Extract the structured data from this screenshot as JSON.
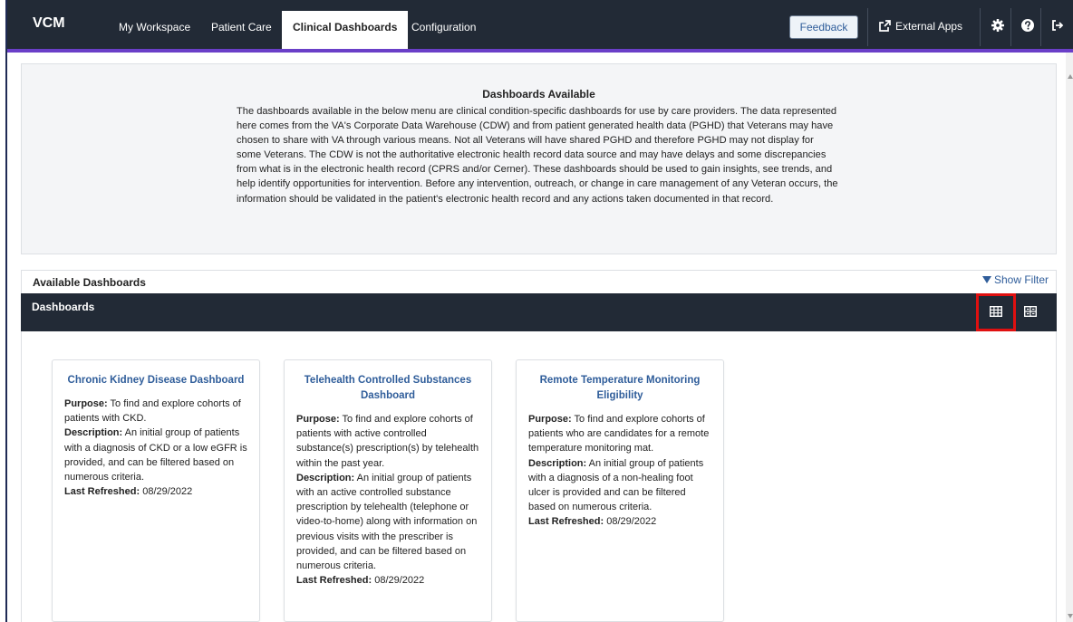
{
  "nav": {
    "brand": "VCM",
    "items": [
      "My Workspace",
      "Patient Care",
      "Clinical Dashboards",
      "Configuration"
    ],
    "feedback": "Feedback",
    "external_apps": "External Apps",
    "icons": [
      "gear-icon",
      "help-icon",
      "logout-icon"
    ]
  },
  "info": {
    "title": "Dashboards Available",
    "body": "The dashboards available in the below menu are clinical condition-specific dashboards for use by care providers. The data represented here comes from the VA's Corporate Data Warehouse (CDW) and from patient generated health data (PGHD) that Veterans may have chosen to share with VA through various means. Not all Veterans will have shared PGHD and therefore PGHD may not display for some Veterans. The CDW is not the authoritative electronic health record data source and may have delays and some discrepancies from what is in the electronic health record (CPRS and/or Cerner). These dashboards should be used to gain insights, see trends, and help identify opportunities for intervention. Before any intervention, outreach, or change in care management of any Veteran occurs, the information should be validated in the patient's electronic health record and any actions taken documented in that record."
  },
  "available": {
    "title": "Available Dashboards",
    "show_filter": "Show Filter",
    "bar_title": "Dashboards",
    "view_icons": [
      "grid-view-icon",
      "list-view-icon"
    ],
    "selected_view": "grid"
  },
  "labels": {
    "purpose": "Purpose:",
    "description": "Description:",
    "refreshed": "Last Refreshed:"
  },
  "cards": [
    {
      "title": "Chronic Kidney Disease Dashboard",
      "purpose": "To find and explore cohorts of patients with CKD.",
      "description": "An initial group of patients with a diagnosis of CKD or a low eGFR is provided, and can be filtered based on numerous criteria.",
      "refreshed": "08/29/2022"
    },
    {
      "title": "Telehealth Controlled Substances Dashboard",
      "purpose": "To find and explore cohorts of patients with active controlled substance(s) prescription(s) by telehealth within the past year.",
      "description": "An initial group of patients with an active controlled substance prescription by telehealth (telephone or video-to-home) along with information on previous visits with the prescriber is provided, and can be filtered based on numerous criteria.",
      "refreshed": "08/29/2022"
    },
    {
      "title": "Remote Temperature Monitoring Eligibility",
      "purpose": "To find and explore cohorts of patients who are candidates for a remote temperature monitoring mat.",
      "description": "An initial group of patients with a diagnosis of a non-healing foot ulcer is provided and can be filtered based on numerous criteria.",
      "refreshed": "08/29/2022"
    }
  ],
  "colors": {
    "nav_bg": "#222a36",
    "accent": "#6a3fc8",
    "link": "#2f5d9a",
    "highlight": "#e01010"
  }
}
